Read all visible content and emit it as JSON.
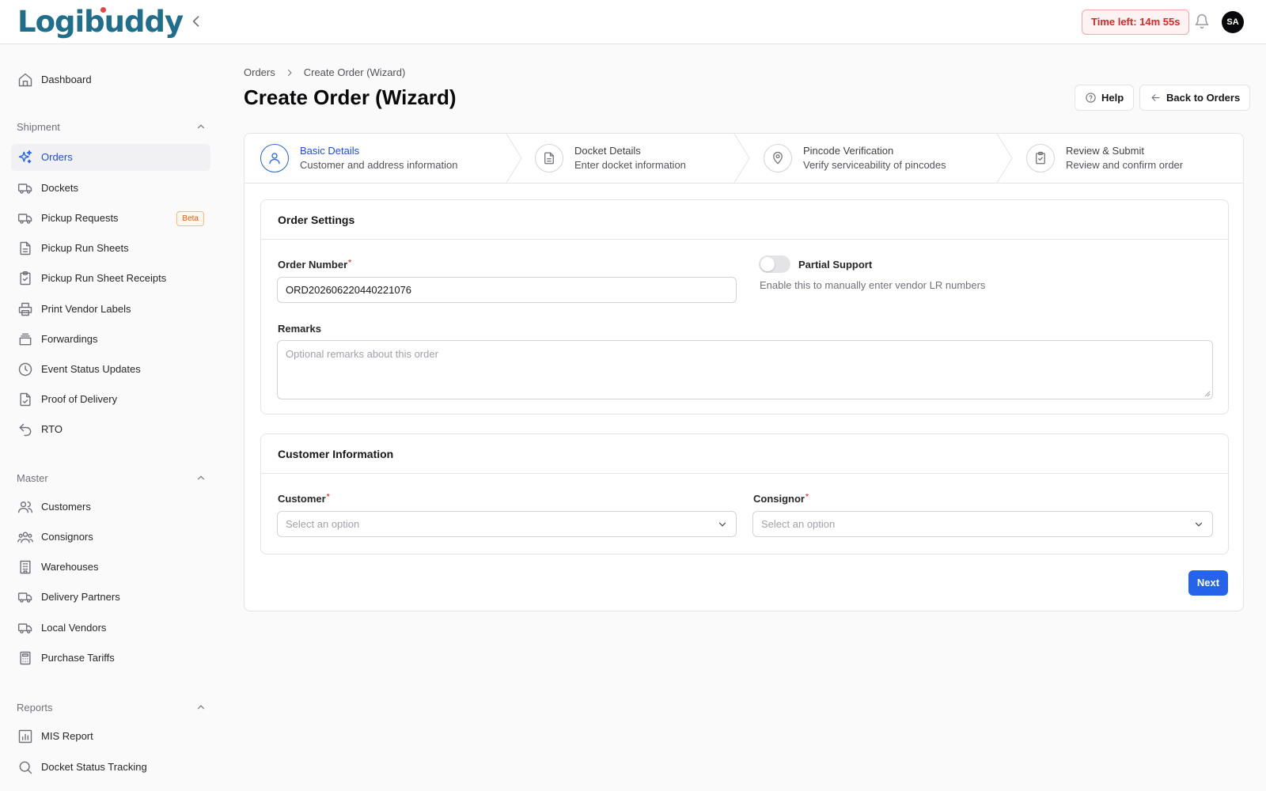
{
  "app": {
    "logo_text": "Logibuddy",
    "accent_color": "#2563eb",
    "brand_color": "#1f6e8c"
  },
  "header": {
    "timer": "Time left: 14m 55s",
    "avatar_initials": "SA"
  },
  "sidebar": {
    "dashboard": "Dashboard",
    "sections": {
      "shipment": {
        "label": "Shipment",
        "items": [
          {
            "label": "Orders",
            "icon": "sparkles-icon",
            "active": true
          },
          {
            "label": "Dockets",
            "icon": "truck-icon"
          },
          {
            "label": "Pickup Requests",
            "icon": "truck-icon",
            "badge": "Beta"
          },
          {
            "label": "Pickup Run Sheets",
            "icon": "file-text-icon"
          },
          {
            "label": "Pickup Run Sheet Receipts",
            "icon": "clipboard-check-icon"
          },
          {
            "label": "Print Vendor Labels",
            "icon": "printer-icon"
          },
          {
            "label": "Forwardings",
            "icon": "layers-icon"
          },
          {
            "label": "Event Status Updates",
            "icon": "clock-icon"
          },
          {
            "label": "Proof of Delivery",
            "icon": "file-check-icon"
          },
          {
            "label": "RTO",
            "icon": "undo-icon"
          }
        ]
      },
      "master": {
        "label": "Master",
        "items": [
          {
            "label": "Customers",
            "icon": "users-icon"
          },
          {
            "label": "Consignors",
            "icon": "users-group-icon"
          },
          {
            "label": "Warehouses",
            "icon": "building-icon"
          },
          {
            "label": "Delivery Partners",
            "icon": "truck-icon"
          },
          {
            "label": "Local Vendors",
            "icon": "truck-icon"
          },
          {
            "label": "Purchase Tariffs",
            "icon": "calculator-icon"
          }
        ]
      },
      "reports": {
        "label": "Reports",
        "items": [
          {
            "label": "MIS Report",
            "icon": "bar-chart-icon"
          },
          {
            "label": "Docket Status Tracking",
            "icon": "search-icon"
          }
        ]
      }
    }
  },
  "breadcrumb": {
    "parent": "Orders",
    "current": "Create Order (Wizard)"
  },
  "page": {
    "title": "Create Order (Wizard)",
    "help_label": "Help",
    "back_label": "Back to Orders"
  },
  "wizard": {
    "steps": [
      {
        "title": "Basic Details",
        "desc": "Customer and address information",
        "icon": "user-icon",
        "active": true
      },
      {
        "title": "Docket Details",
        "desc": "Enter docket information",
        "icon": "file-text-icon"
      },
      {
        "title": "Pincode Verification",
        "desc": "Verify serviceability of pincodes",
        "icon": "map-pin-icon"
      },
      {
        "title": "Review & Submit",
        "desc": "Review and confirm order",
        "icon": "clipboard-check-icon"
      }
    ],
    "order_settings": {
      "title": "Order Settings",
      "order_number_label": "Order Number",
      "order_number_value": "ORD202606220440221076",
      "partial_support_label": "Partial Support",
      "partial_support_help": "Enable this to manually enter vendor LR numbers",
      "partial_support_on": false,
      "remarks_label": "Remarks",
      "remarks_placeholder": "Optional remarks about this order"
    },
    "customer_info": {
      "title": "Customer Information",
      "customer_label": "Customer",
      "customer_placeholder": "Select an option",
      "consignor_label": "Consignor",
      "consignor_placeholder": "Select an option"
    },
    "next_label": "Next"
  }
}
